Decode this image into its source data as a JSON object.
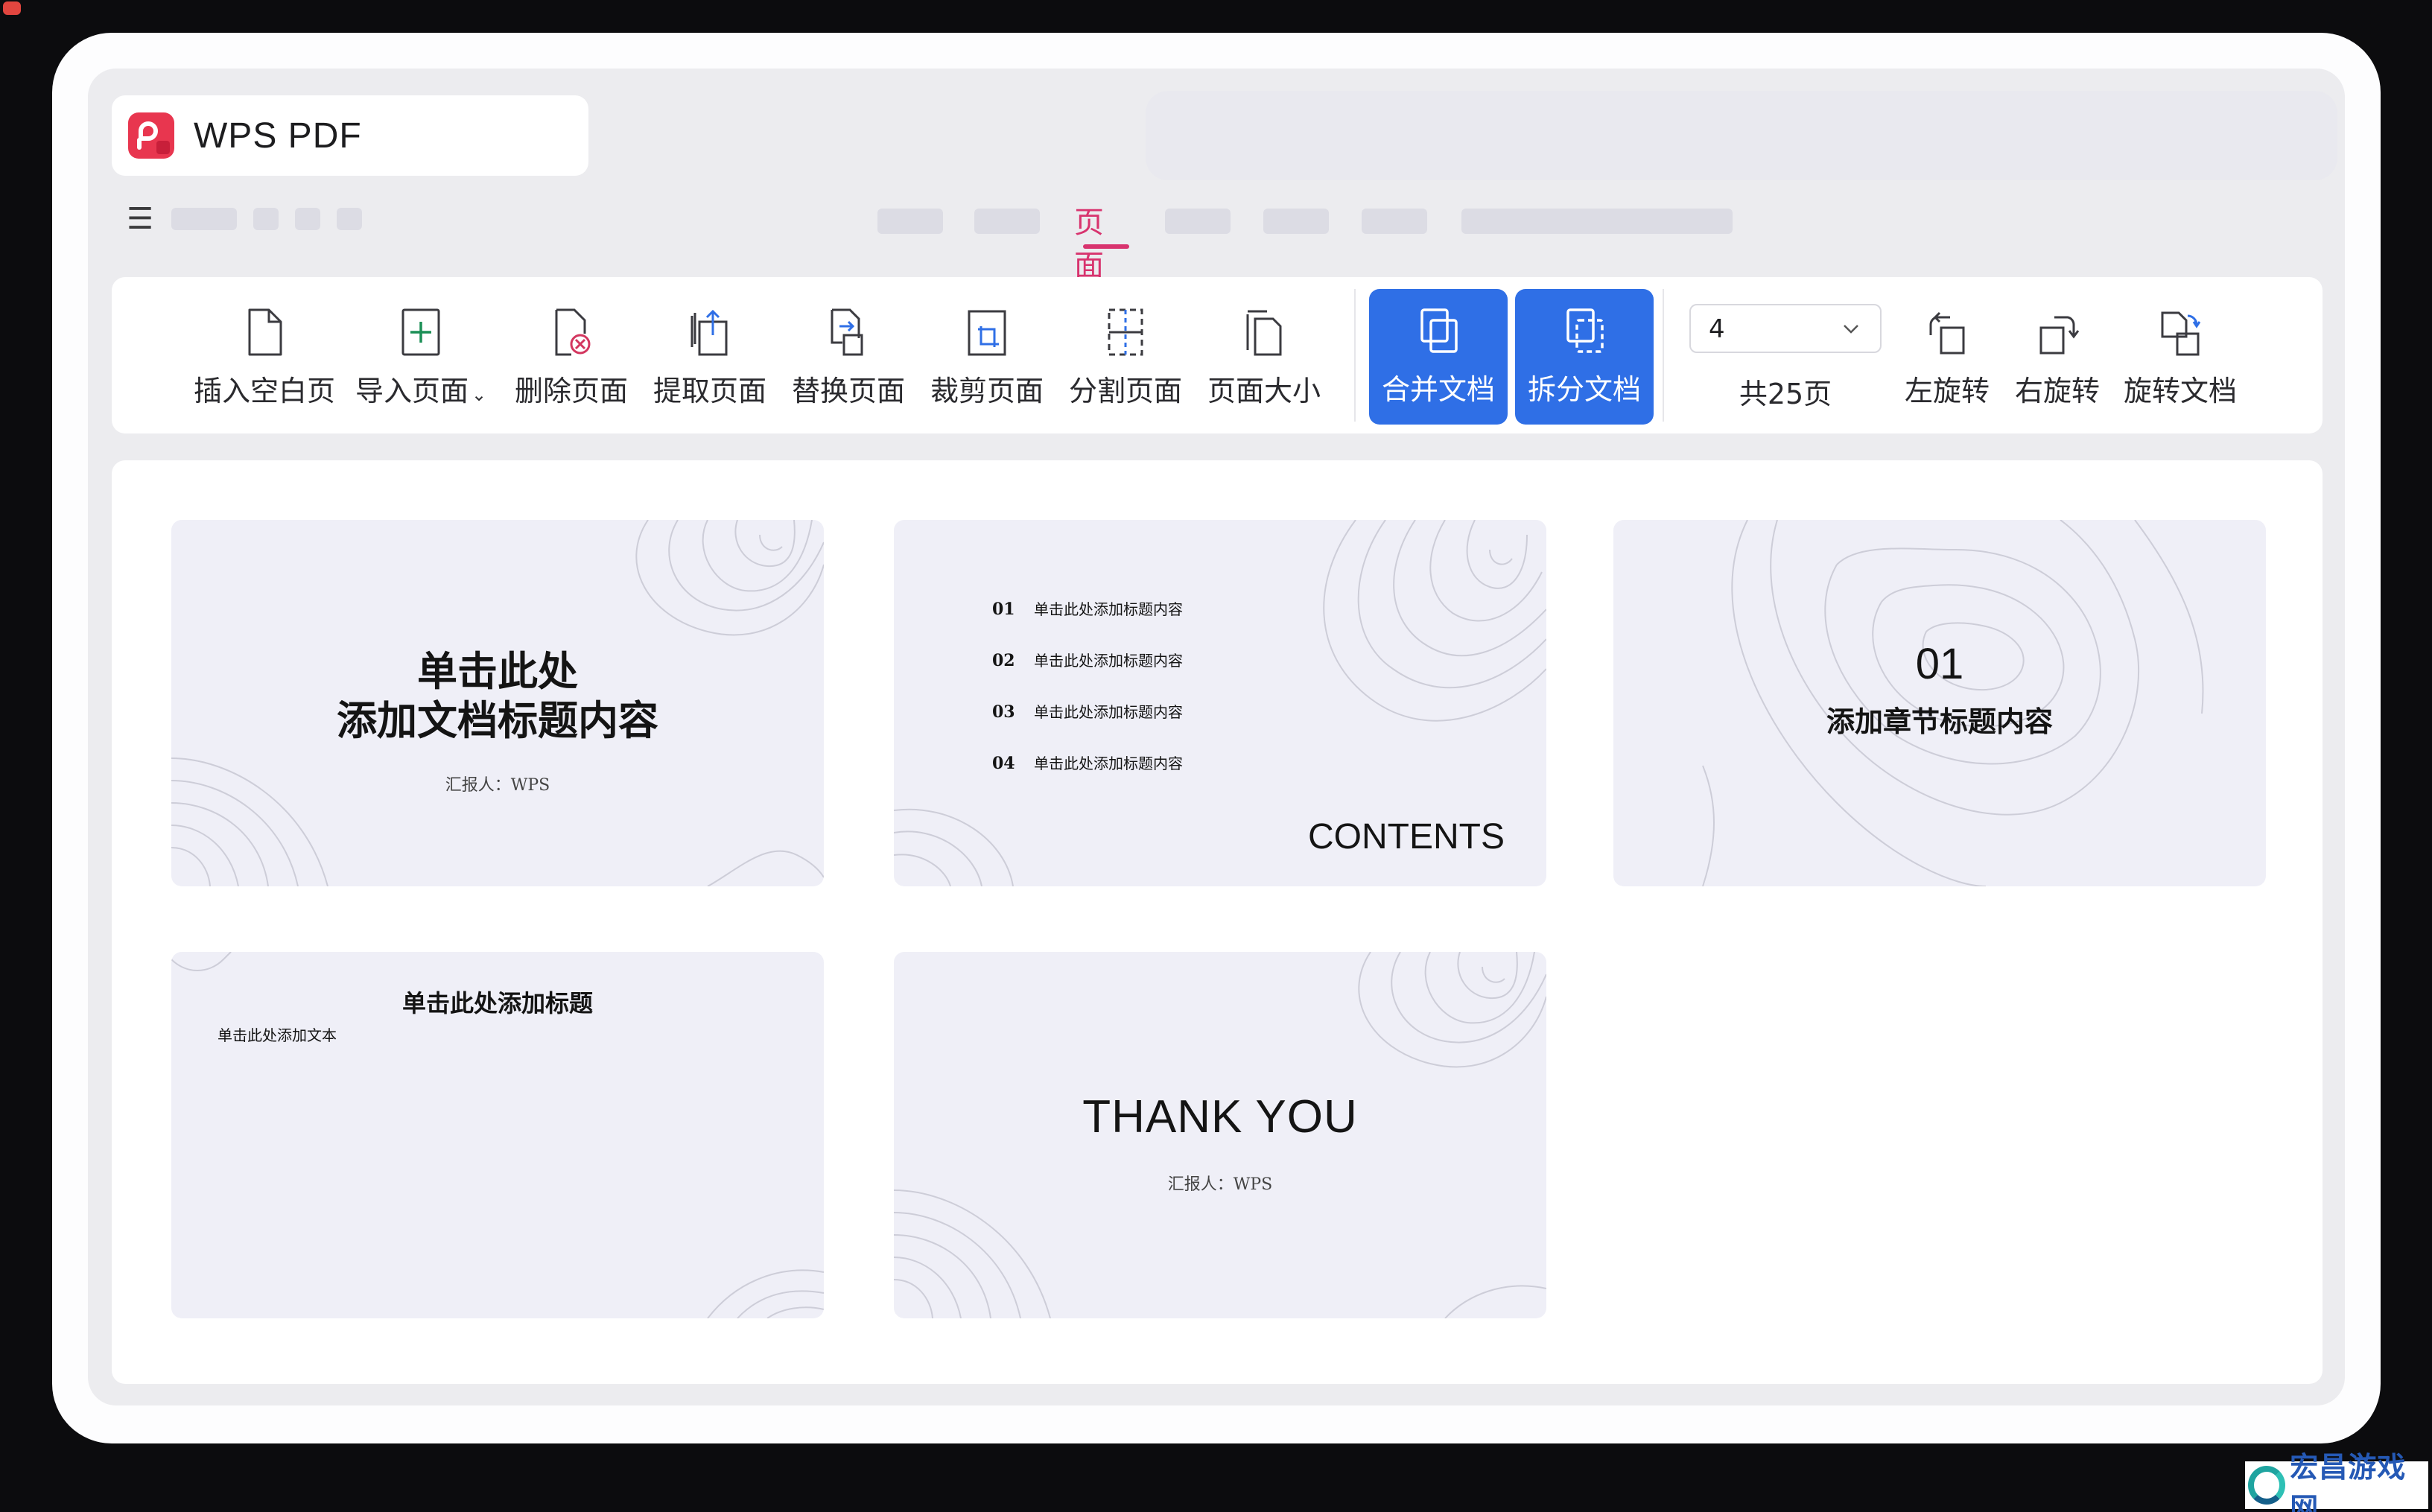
{
  "app": {
    "name": "WPS PDF"
  },
  "tabs": {
    "active": "页面"
  },
  "toolbar": {
    "tools": [
      {
        "label": "插入空白页",
        "icon": "blank-page-icon"
      },
      {
        "label": "导入页面",
        "icon": "import-page-icon",
        "dropdown": true
      },
      {
        "label": "删除页面",
        "icon": "delete-page-icon"
      },
      {
        "label": "提取页面",
        "icon": "extract-page-icon"
      },
      {
        "label": "替换页面",
        "icon": "replace-page-icon"
      },
      {
        "label": "裁剪页面",
        "icon": "crop-page-icon"
      },
      {
        "label": "分割页面",
        "icon": "split-page-icon"
      },
      {
        "label": "页面大小",
        "icon": "page-size-icon"
      }
    ],
    "merge": {
      "label": "合并文档",
      "icon": "merge-document-icon"
    },
    "split": {
      "label": "拆分文档",
      "icon": "split-document-icon"
    },
    "page_selector": {
      "value": "4",
      "total": "共25页"
    },
    "rotate_left": {
      "label": "左旋转",
      "icon": "rotate-left-icon"
    },
    "rotate_right": {
      "label": "右旋转",
      "icon": "rotate-right-icon"
    },
    "rotate_doc": {
      "label": "旋转文档",
      "icon": "rotate-document-icon"
    },
    "accent": "#2f6fe6"
  },
  "slides": {
    "s1": {
      "title_line1": "单击此处",
      "title_line2": "添加文档标题内容",
      "reporter": "汇报人：WPS"
    },
    "s2": {
      "items": [
        {
          "num": "01",
          "text": "单击此处添加标题内容"
        },
        {
          "num": "02",
          "text": "单击此处添加标题内容"
        },
        {
          "num": "03",
          "text": "单击此处添加标题内容"
        },
        {
          "num": "04",
          "text": "单击此处添加标题内容"
        }
      ],
      "heading": "CONTENTS"
    },
    "s3": {
      "num": "01",
      "title": "添加章节标题内容"
    },
    "s4": {
      "title": "单击此处添加标题",
      "body": "单击此处添加文本"
    },
    "s5": {
      "title": "THANK YOU",
      "reporter": "汇报人：WPS"
    }
  },
  "watermark": {
    "text": "宏昌游戏网"
  }
}
